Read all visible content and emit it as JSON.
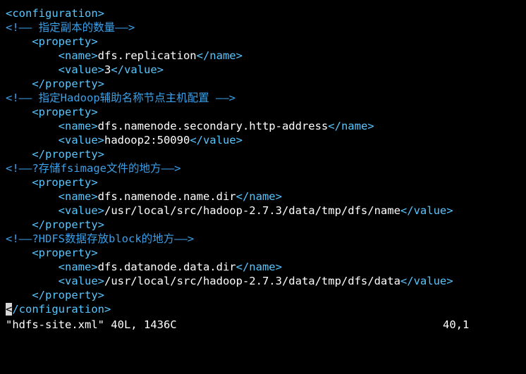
{
  "theme": {
    "background": "#000000",
    "tag_color": "#58c6ff",
    "comment_color": "#3aa0e8",
    "text_color": "#ffffff",
    "cursor_color": "#d7d7d7"
  },
  "editor": {
    "lines": [
      {
        "parts": [
          {
            "type": "tag",
            "text": "<configuration>"
          }
        ]
      },
      {
        "parts": [
          {
            "type": "comment",
            "text": "<!—— 指定副本的数量——>"
          }
        ]
      },
      {
        "parts": [
          {
            "type": "tag",
            "text": "    <property>"
          }
        ]
      },
      {
        "parts": [
          {
            "type": "tag",
            "text": "        <name>"
          },
          {
            "type": "text",
            "text": "dfs.replication"
          },
          {
            "type": "tag",
            "text": "</name>"
          }
        ]
      },
      {
        "parts": [
          {
            "type": "tag",
            "text": "        <value>"
          },
          {
            "type": "text",
            "text": "3"
          },
          {
            "type": "tag",
            "text": "</value>"
          }
        ]
      },
      {
        "parts": [
          {
            "type": "tag",
            "text": "    </property>"
          }
        ]
      },
      {
        "parts": [
          {
            "type": "comment",
            "text": "<!—— 指定Hadoop辅助名称节点主机配置 ——>"
          }
        ]
      },
      {
        "parts": [
          {
            "type": "tag",
            "text": "    <property>"
          }
        ]
      },
      {
        "parts": [
          {
            "type": "tag",
            "text": "        <name>"
          },
          {
            "type": "text",
            "text": "dfs.namenode.secondary.http-address"
          },
          {
            "type": "tag",
            "text": "</name>"
          }
        ]
      },
      {
        "parts": [
          {
            "type": "tag",
            "text": "        <value>"
          },
          {
            "type": "text",
            "text": "hadoop2:50090"
          },
          {
            "type": "tag",
            "text": "</value>"
          }
        ]
      },
      {
        "parts": [
          {
            "type": "tag",
            "text": "    </property>"
          }
        ]
      },
      {
        "parts": [
          {
            "type": "comment",
            "text": "<!——?存储fsimage文件的地方——>"
          }
        ]
      },
      {
        "parts": [
          {
            "type": "tag",
            "text": "    <property>"
          }
        ]
      },
      {
        "parts": [
          {
            "type": "tag",
            "text": "        <name>"
          },
          {
            "type": "text",
            "text": "dfs.namenode.name.dir"
          },
          {
            "type": "tag",
            "text": "</name>"
          }
        ]
      },
      {
        "parts": [
          {
            "type": "tag",
            "text": "        <value>"
          },
          {
            "type": "text",
            "text": "/usr/local/src/hadoop-2.7.3/data/tmp/dfs/name"
          },
          {
            "type": "tag",
            "text": "</value>"
          }
        ]
      },
      {
        "parts": [
          {
            "type": "tag",
            "text": "    </property>"
          }
        ]
      },
      {
        "parts": [
          {
            "type": "comment",
            "text": "<!——?HDFS数据存放block的地方——>"
          }
        ]
      },
      {
        "parts": [
          {
            "type": "tag",
            "text": "    <property>"
          }
        ]
      },
      {
        "parts": [
          {
            "type": "tag",
            "text": "        <name>"
          },
          {
            "type": "text",
            "text": "dfs.datanode.data.dir"
          },
          {
            "type": "tag",
            "text": "</name>"
          }
        ]
      },
      {
        "parts": [
          {
            "type": "tag",
            "text": "        <value>"
          },
          {
            "type": "text",
            "text": "/usr/local/src/hadoop-2.7.3/data/tmp/dfs/data"
          },
          {
            "type": "tag",
            "text": "</value>"
          }
        ]
      },
      {
        "parts": [
          {
            "type": "tag",
            "text": "    </property>"
          }
        ]
      },
      {
        "parts": [
          {
            "type": "cursor",
            "text": "<"
          },
          {
            "type": "tag",
            "text": "/configuration>"
          }
        ]
      }
    ]
  },
  "statusbar": {
    "file_info": "\"hdfs-site.xml\" 40L, 1436C",
    "position": "40,1"
  }
}
